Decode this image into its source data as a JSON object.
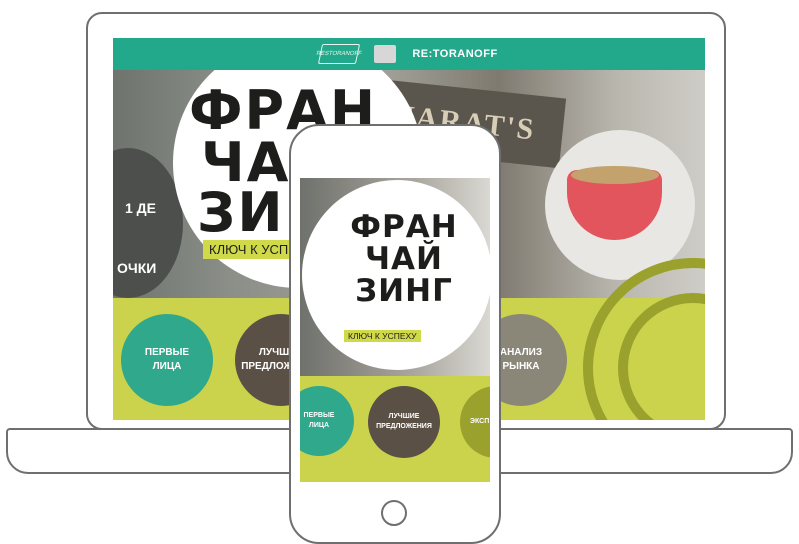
{
  "laptop": {
    "topbar": {
      "logo1_text": "RESTORANOFF",
      "logo_text": "RE:TORANOFF",
      "color": "#22a88a"
    },
    "sign_text": "HARAT'S PUB",
    "left_circle_text1": "1 ДЕ",
    "left_circle_text2": "ОЧКИ",
    "hero": {
      "line1": "ФРАН",
      "line2": "ЧАЙ",
      "line3": "ЗИНГ",
      "tagline": "КЛЮЧ К УСПЕХУ"
    },
    "circles": [
      {
        "label": "ПЕРВЫЕ\nЛИЦА",
        "color": "#2fa88c"
      },
      {
        "label": "ЛУЧШИЕ\nПРЕДЛОЖЕНИЯ",
        "color": "#5b5046"
      },
      {
        "label": "АНАЛИЗ\nРЫНКА",
        "color": "#8a8778"
      }
    ],
    "band_color": "#cbd34c"
  },
  "phone": {
    "hero": {
      "line1": "ФРАН",
      "line2": "ЧАЙ",
      "line3": "ЗИНГ",
      "tagline": "КЛЮЧ К УСПЕХУ"
    },
    "circles": [
      {
        "label": "ПЕРВЫЕ\nЛИЦА",
        "color": "#2fa88c"
      },
      {
        "label": "ЛУЧШИЕ\nПРЕДЛОЖЕНИЯ",
        "color": "#5b5046"
      },
      {
        "label": "ЭКСП",
        "color": "#9aa12c"
      }
    ]
  }
}
